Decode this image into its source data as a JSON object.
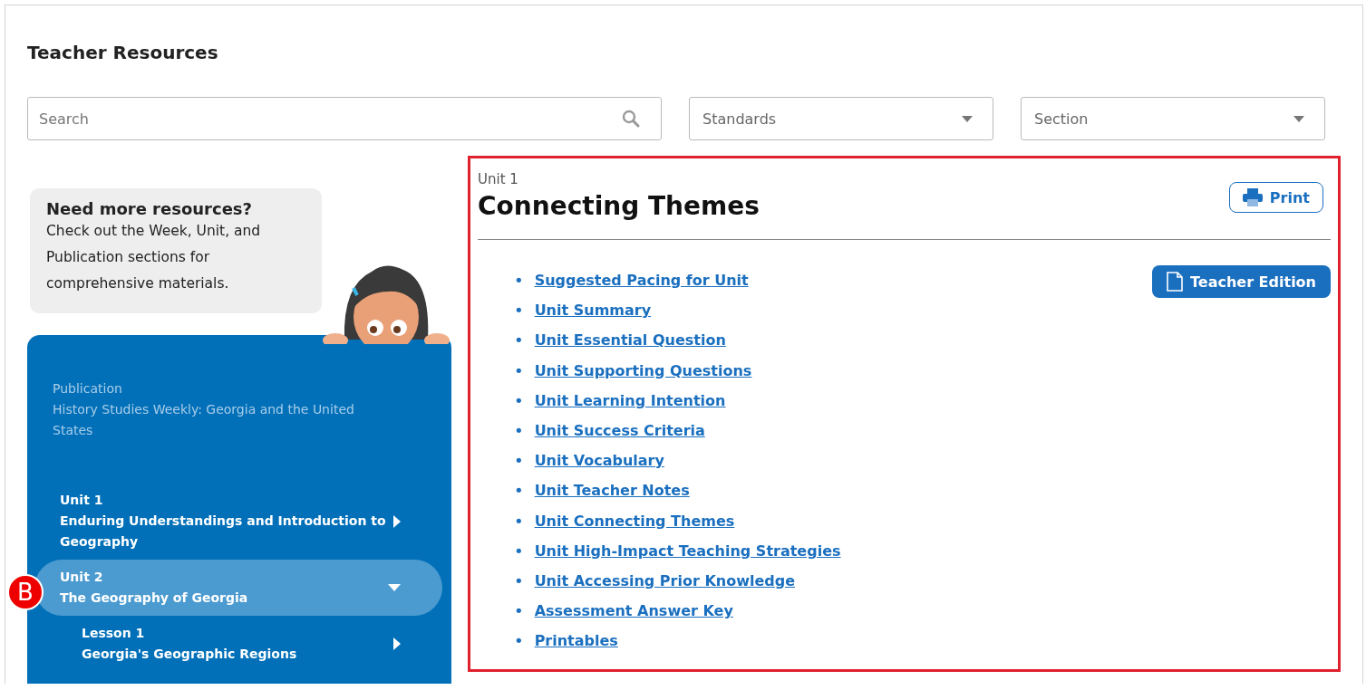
{
  "page": {
    "title": "Teacher Resources"
  },
  "filters": {
    "search": {
      "placeholder": "Search"
    },
    "dropdowns": [
      {
        "placeholder": "Standards"
      },
      {
        "placeholder": "Section"
      }
    ]
  },
  "callout": {
    "heading": "Need more resources?",
    "text": "Check out the Week, Unit, and Publication sections for comprehensive materials."
  },
  "publication": {
    "label": "Publication",
    "title": "History Studies Weekly: Georgia and the United States"
  },
  "tree": [
    {
      "label": "Unit 1",
      "title": "Enduring Understandings and Introduction to Geography",
      "expanded": false,
      "selected": false
    },
    {
      "label": "Unit 2",
      "title": "The Geography of Georgia",
      "expanded": true,
      "selected": true,
      "marker": "B",
      "children": [
        {
          "label": "Lesson 1",
          "title": "Georgia's Geographic Regions",
          "expanded": false,
          "selected": false
        }
      ]
    }
  ],
  "content": {
    "eyebrow": "Unit 1",
    "title": "Connecting Themes",
    "print_button": "Print",
    "pdf_button": "Teacher Edition",
    "bullet": "•",
    "links": [
      "Suggested Pacing for Unit",
      "Unit Summary",
      "Unit Essential Question",
      "Unit Supporting Questions",
      "Unit Learning Intention",
      "Unit Success Criteria",
      "Unit Vocabulary",
      "Unit Teacher Notes",
      "Unit Connecting Themes",
      "Unit High-Impact Teaching Strategies",
      "Unit Accessing Prior Knowledge",
      "Assessment Answer Key",
      "Printables"
    ]
  }
}
